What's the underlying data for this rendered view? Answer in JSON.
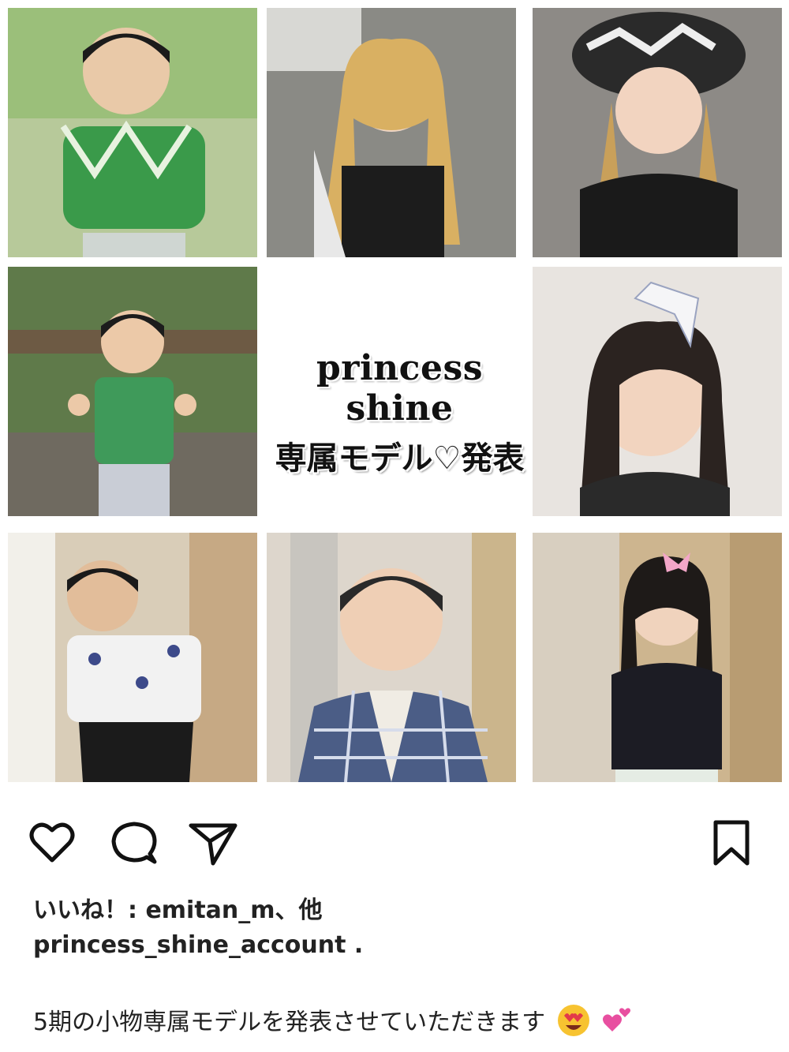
{
  "post": {
    "title": "princess shine",
    "subtitle": "専属モデル♡発表",
    "photos": [
      {
        "name": "model-photo-1",
        "bg": "#9bbf7a",
        "outfit": "#3a9a4a"
      },
      {
        "name": "model-photo-2",
        "bg": "#8a8a85",
        "outfit": "#222222"
      },
      {
        "name": "model-photo-3",
        "bg": "#8d8a86",
        "outfit": "#1a1a1a"
      },
      {
        "name": "model-photo-4",
        "bg": "#5f7a4a",
        "outfit": "#3f9a5a"
      },
      {
        "name": "model-photo-6",
        "bg": "#e8e4e0",
        "outfit": "#2a2a2a"
      },
      {
        "name": "model-photo-7",
        "bg": "#d9cdb8",
        "outfit": "#f2f2f2"
      },
      {
        "name": "model-photo-8",
        "bg": "#ddd6cc",
        "outfit": "#4b5d86"
      },
      {
        "name": "model-photo-9",
        "bg": "#cdb58f",
        "outfit": "#1c1c24"
      }
    ]
  },
  "actions": {
    "like_icon": "heart-icon",
    "comment_icon": "comment-icon",
    "share_icon": "paper-plane-icon",
    "save_icon": "bookmark-icon"
  },
  "likes": {
    "text": "いいね！: emitan_m、他"
  },
  "account": {
    "username": "princess_shine_account ."
  },
  "caption": {
    "text": "5期の小物専属モデルを発表させていただきます"
  },
  "colors": {
    "text": "#222222",
    "emoji_face": "#f7c331",
    "emoji_heart": "#e84fa0"
  }
}
